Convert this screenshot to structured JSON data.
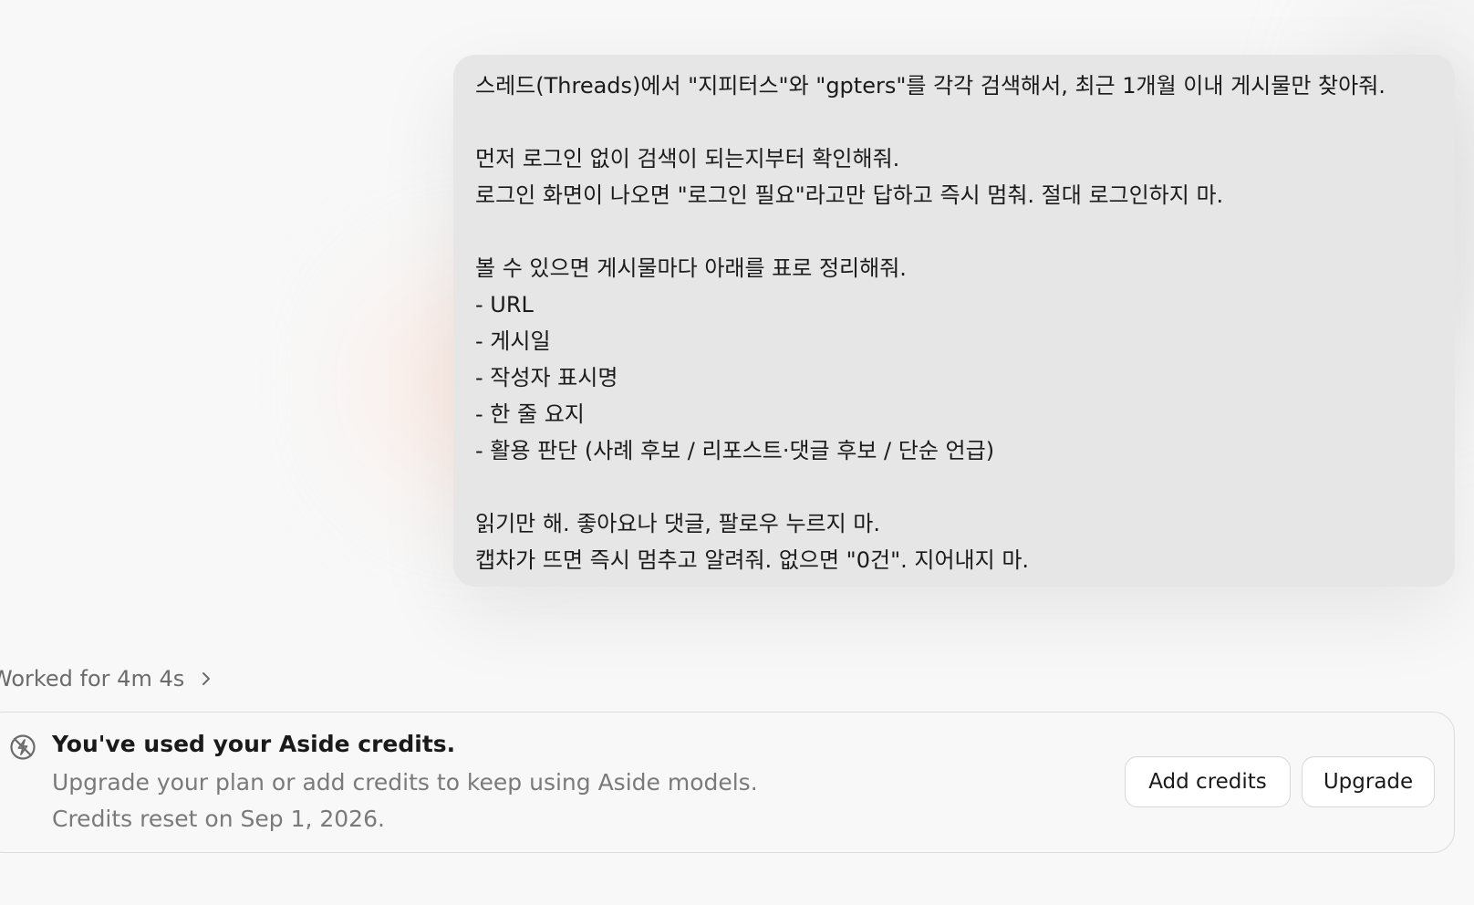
{
  "user_message": {
    "lines": [
      "스레드(Threads)에서 \"지피터스\"와 \"gpters\"를 각각 검색해서, 최근 1개월 이내 게시물만 찾아줘.",
      "",
      "먼저 로그인 없이 검색이 되는지부터 확인해줘.",
      "로그인 화면이 나오면 \"로그인 필요\"라고만 답하고 즉시 멈춰. 절대 로그인하지 마.",
      "",
      "볼 수 있으면 게시물마다 아래를 표로 정리해줘.",
      "- URL",
      "- 게시일",
      "- 작성자 표시명",
      "- 한 줄 요지",
      "- 활용 판단 (사례 후보 / 리포스트·댓글 후보 / 단순 언급)",
      "",
      "읽기만 해. 좋아요나 댓글, 팔로우 누르지 마.",
      "캡차가 뜨면 즉시 멈추고 알려줘. 없으면 \"0건\". 지어내지 마."
    ]
  },
  "worked": {
    "label": "Worked for 4m 4s",
    "icon": "chevron-right-icon"
  },
  "credits_notice": {
    "icon": "no-credits-icon",
    "title": "You've used your Aside credits.",
    "subtitle": "Upgrade your plan or add credits to keep using Aside models.",
    "reset_text": "Credits reset on Sep 1, 2026.",
    "add_credits_label": "Add credits",
    "upgrade_label": "Upgrade"
  },
  "colors": {
    "background": "#f8f8f8",
    "bubble": "#e6e6e6",
    "muted_text": "#7a7a7a",
    "border": "#dcdcdc"
  }
}
